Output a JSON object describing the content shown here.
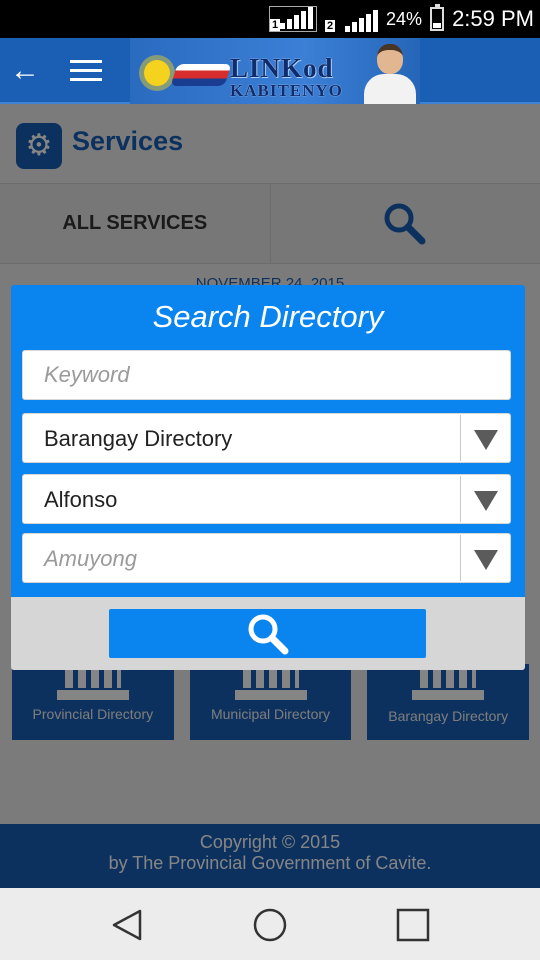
{
  "status_bar": {
    "sim1_label": "1",
    "sim2_label": "2",
    "battery_percent": "24%",
    "time": "2:59 PM"
  },
  "app_bar": {
    "logo_title": "LINKod",
    "logo_subtitle": "KABITENYO"
  },
  "page": {
    "title": "Services"
  },
  "tabs": {
    "all_services_label": "ALL SERVICES"
  },
  "date_text": "NOVEMBER 24, 2015",
  "tiles": [
    {
      "label": "Provincial Directory"
    },
    {
      "label": "Municipal Directory"
    },
    {
      "label": "Barangay Directory"
    }
  ],
  "footer": {
    "line1": "Copyright © 2015",
    "line2": "by The Provincial Government of Cavite."
  },
  "dialog": {
    "title": "Search Directory",
    "keyword_placeholder": "Keyword",
    "keyword_value": "",
    "directory_type_value": "Barangay Directory",
    "municipality_value": "Alfonso",
    "barangay_placeholder": "Amuyong"
  },
  "colors": {
    "primary_blue": "#1a5fb4",
    "dialog_blue": "#0a84ef"
  }
}
